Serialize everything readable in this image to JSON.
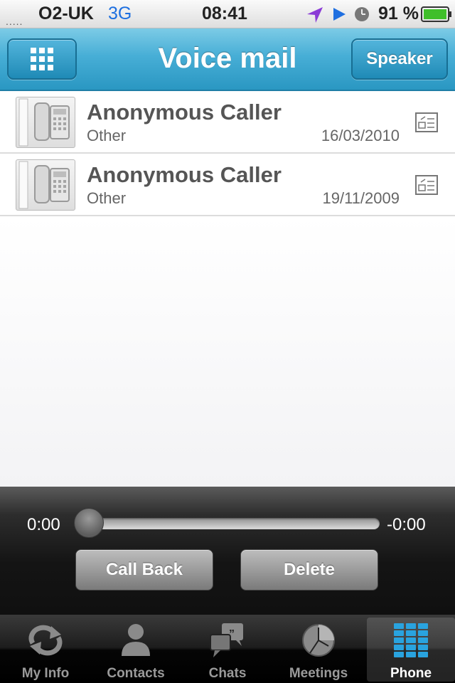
{
  "status_bar": {
    "carrier": "O2-UK",
    "network": "3G",
    "time": "08:41",
    "battery": "91 %",
    "signal_dots": ".....",
    "icons": [
      "location-arrow-icon",
      "play-icon",
      "clock-icon",
      "battery-icon"
    ]
  },
  "nav": {
    "title": "Voice mail",
    "left_icon": "keypad-icon",
    "right_button": "Speaker"
  },
  "voicemails": [
    {
      "name": "Anonymous Caller",
      "type": "Other",
      "date": "16/03/2010"
    },
    {
      "name": "Anonymous Caller",
      "type": "Other",
      "date": "19/11/2009"
    }
  ],
  "player": {
    "elapsed": "0:00",
    "remaining": "-0:00",
    "progress": 0,
    "call_back_label": "Call Back",
    "delete_label": "Delete"
  },
  "tabs": [
    {
      "label": "My Info",
      "icon": "sync-icon",
      "selected": false
    },
    {
      "label": "Contacts",
      "icon": "person-icon",
      "selected": false
    },
    {
      "label": "Chats",
      "icon": "chat-bubbles-icon",
      "selected": false
    },
    {
      "label": "Meetings",
      "icon": "clock-pie-icon",
      "selected": false
    },
    {
      "label": "Phone",
      "icon": "phone-keypad-icon",
      "selected": true
    }
  ],
  "colors": {
    "nav_blue": "#47aed6",
    "tab_selected_icon": "#29a3df",
    "battery_green": "#3fbf2a"
  }
}
